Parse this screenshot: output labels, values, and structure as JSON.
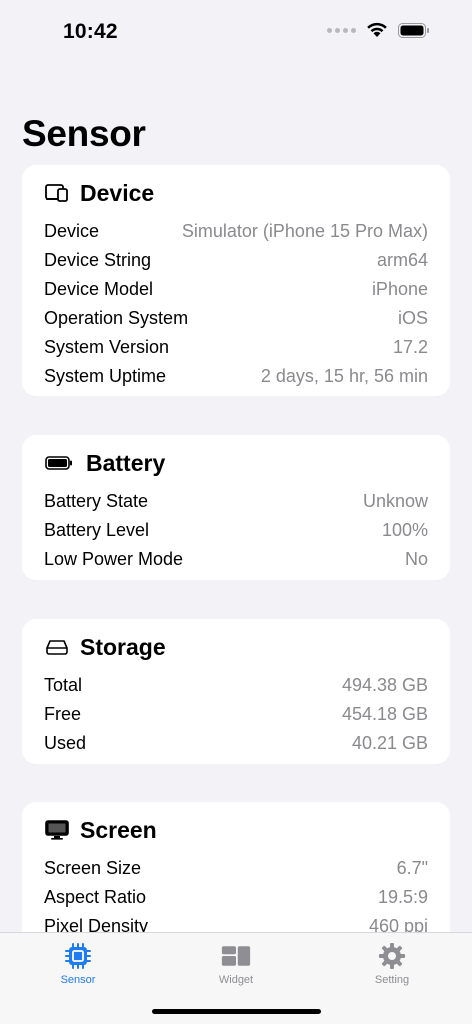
{
  "status_bar": {
    "time": "10:42"
  },
  "page_title": "Sensor",
  "device": {
    "title": "Device",
    "rows": [
      {
        "label": "Device",
        "value": "Simulator (iPhone 15 Pro Max)"
      },
      {
        "label": "Device String",
        "value": "arm64"
      },
      {
        "label": "Device Model",
        "value": "iPhone"
      },
      {
        "label": "Operation System",
        "value": "iOS"
      },
      {
        "label": "System Version",
        "value": "17.2"
      },
      {
        "label": "System Uptime",
        "value": "2 days, 15 hr, 56 min"
      }
    ]
  },
  "battery": {
    "title": "Battery",
    "rows": [
      {
        "label": "Battery State",
        "value": "Unknow"
      },
      {
        "label": "Battery Level",
        "value": "100%"
      },
      {
        "label": "Low Power Mode",
        "value": "No"
      }
    ]
  },
  "storage": {
    "title": "Storage",
    "rows": [
      {
        "label": "Total",
        "value": "494.38 GB"
      },
      {
        "label": "Free",
        "value": "454.18 GB"
      },
      {
        "label": "Used",
        "value": "40.21 GB"
      }
    ]
  },
  "screen": {
    "title": "Screen",
    "rows": [
      {
        "label": "Screen Size",
        "value": "6.7\""
      },
      {
        "label": "Aspect Ratio",
        "value": "19.5:9"
      },
      {
        "label": "Pixel Density",
        "value": "460 ppi"
      }
    ]
  },
  "tabs": [
    {
      "label": "Sensor",
      "icon": "cpu-chip-icon",
      "active": true
    },
    {
      "label": "Widget",
      "icon": "widget-grid-icon",
      "active": false
    },
    {
      "label": "Setting",
      "icon": "gear-icon",
      "active": false
    }
  ],
  "colors": {
    "accent": "#1f7cf0",
    "background": "#f2f2f7",
    "secondary_text": "#8a8a8e"
  }
}
